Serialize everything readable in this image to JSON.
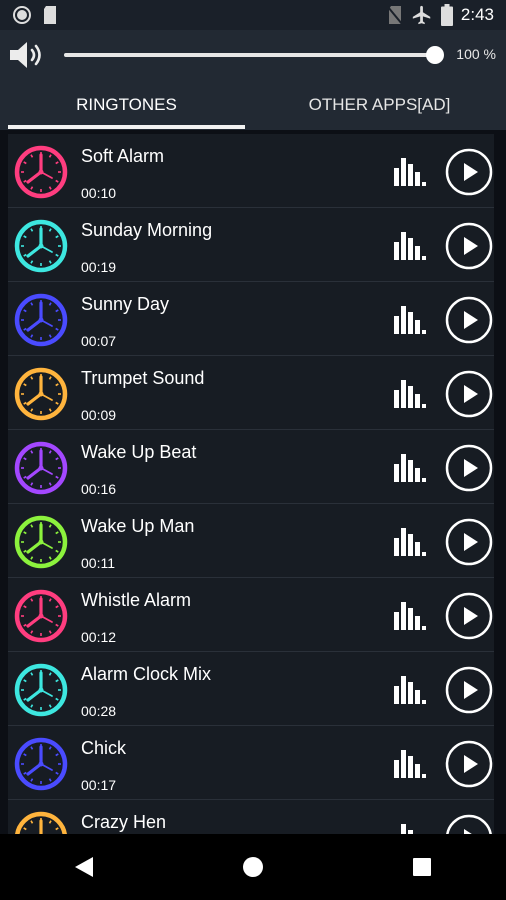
{
  "status_bar": {
    "time": "2:43",
    "left_icons": [
      "record-icon",
      "sd-card-icon"
    ],
    "right_icons": [
      "no-sim-icon",
      "airplane-mode-icon",
      "battery-icon"
    ]
  },
  "volume": {
    "icon": "speaker-icon",
    "level": 1.0,
    "percent_label": "100 %"
  },
  "tabs": [
    {
      "label": "RINGTONES",
      "active": true
    },
    {
      "label": "OTHER APPS[AD]",
      "active": false
    }
  ],
  "ringtones": [
    {
      "title": "Soft Alarm",
      "duration": "00:10",
      "color": "#ff3d7f"
    },
    {
      "title": "Sunday Morning",
      "duration": "00:19",
      "color": "#3de7e0"
    },
    {
      "title": "Sunny Day",
      "duration": "00:07",
      "color": "#4a4bff"
    },
    {
      "title": "Trumpet Sound",
      "duration": "00:09",
      "color": "#ffb43d"
    },
    {
      "title": "Wake Up Beat",
      "duration": "00:16",
      "color": "#a347ff"
    },
    {
      "title": "Wake Up Man",
      "duration": "00:11",
      "color": "#8cf23d"
    },
    {
      "title": "Whistle Alarm",
      "duration": "00:12",
      "color": "#ff3d7f"
    },
    {
      "title": "Alarm Clock Mix",
      "duration": "00:28",
      "color": "#3de7e0"
    },
    {
      "title": "Chick",
      "duration": "00:17",
      "color": "#4a4bff"
    },
    {
      "title": "Crazy Hen",
      "duration": "",
      "color": "#ffb43d"
    }
  ],
  "row_icons": {
    "clock": "alarm-clock-icon",
    "levels": "sound-levels-icon",
    "play": "play-icon"
  },
  "nav_bar": {
    "icons": [
      "back-icon",
      "home-icon",
      "recents-icon"
    ]
  }
}
